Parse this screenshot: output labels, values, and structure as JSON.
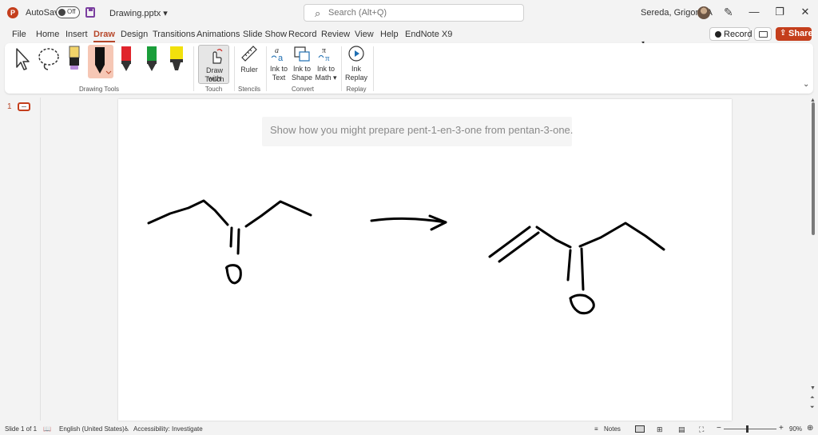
{
  "titlebar": {
    "app_logo": "P",
    "autosave_label": "AutoSave",
    "autosave_state": "Off",
    "filename": "Drawing.pptx ▾",
    "search_placeholder": "Search (Alt+Q)",
    "user_name": "Sereda, Grigoriy A",
    "minimize": "—",
    "restore": "❐",
    "close": "✕"
  },
  "menu": {
    "tabs": [
      "File",
      "Home",
      "Insert",
      "Draw",
      "Design",
      "Transitions",
      "Animations",
      "Slide Show",
      "Record",
      "Review",
      "View",
      "Help",
      "EndNote X9"
    ],
    "active_tab": "Draw",
    "record_label": "Record",
    "share_label": "Share"
  },
  "ribbon": {
    "groups": {
      "drawing_tools": "Drawing Tools",
      "touch": "Touch",
      "stencils": "Stencils",
      "convert": "Convert",
      "replay": "Replay"
    },
    "buttons": {
      "draw_with_touch": [
        "Draw with",
        "Touch"
      ],
      "ruler": "Ruler",
      "ink_to_text": [
        "Ink to",
        "Text"
      ],
      "ink_to_shape": [
        "Ink to",
        "Shape"
      ],
      "ink_to_math": [
        "Ink to",
        "Math ▾"
      ],
      "ink_replay": [
        "Ink",
        "Replay"
      ]
    },
    "pen_colors": {
      "black": "#111111",
      "red": "#e0242c",
      "green": "#1a9e3a",
      "yellow": "#f2e10c",
      "selected_bg": "#f6c7b5"
    }
  },
  "thumbnails": {
    "slide_number": "1"
  },
  "slide": {
    "prompt": "Show how you might prepare pent-1-en-3-one from pentan-3-one."
  },
  "status": {
    "slide_counter": "Slide 1 of 1",
    "language": "English (United States)",
    "accessibility": "Accessibility: Investigate",
    "notes": "Notes",
    "zoom_minus": "−",
    "zoom_plus": "+",
    "zoom": "90%"
  }
}
